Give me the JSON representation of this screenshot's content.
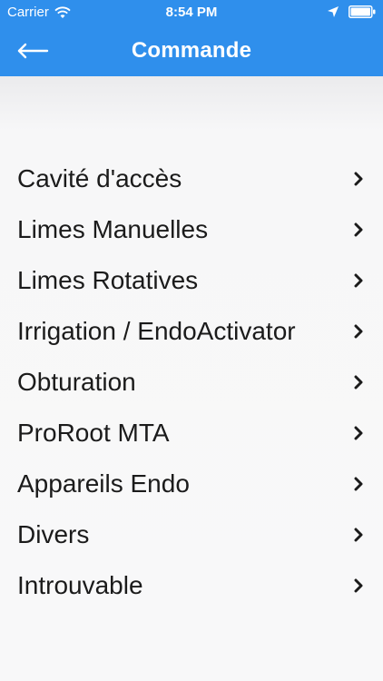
{
  "status_bar": {
    "carrier": "Carrier",
    "time": "8:54 PM",
    "icons": [
      "wifi-icon",
      "location-icon",
      "battery-icon"
    ]
  },
  "nav": {
    "title": "Commande",
    "back_icon": "back-arrow-icon"
  },
  "menu": {
    "items": [
      {
        "label": "Cavité d'accès"
      },
      {
        "label": "Limes Manuelles"
      },
      {
        "label": "Limes Rotatives"
      },
      {
        "label": "Irrigation / EndoActivator"
      },
      {
        "label": "Obturation"
      },
      {
        "label": "ProRoot MTA"
      },
      {
        "label": "Appareils Endo"
      },
      {
        "label": "Divers"
      },
      {
        "label": "Introuvable"
      }
    ],
    "chevron_icon": "chevron-right-icon"
  },
  "colors": {
    "header_background": "#2f8fec",
    "text": "#1b1b1b",
    "background": "#f8f8f9"
  }
}
